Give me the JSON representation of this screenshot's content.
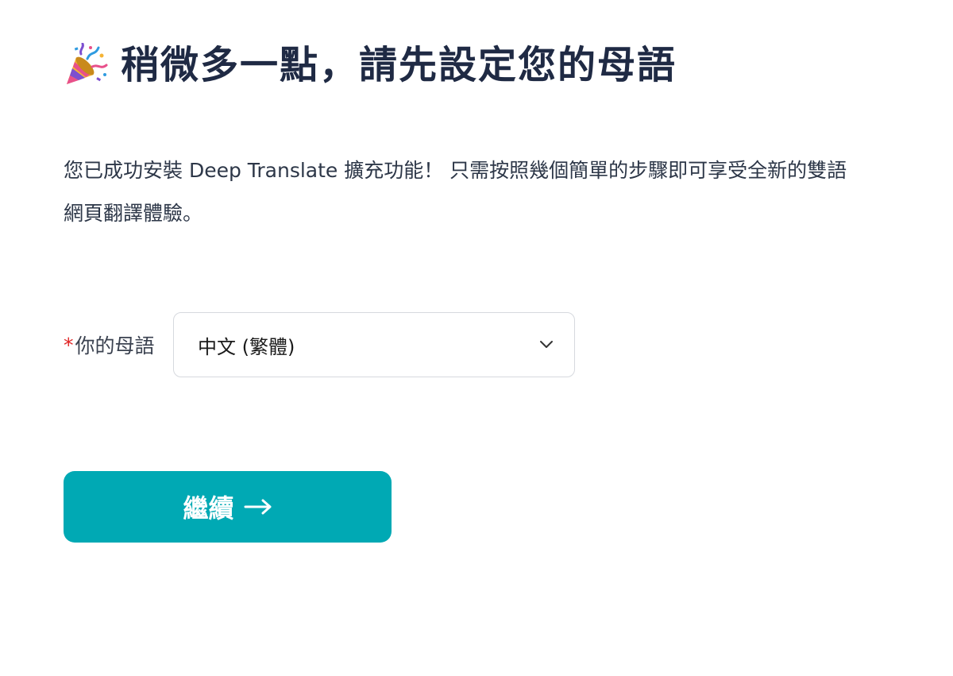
{
  "header": {
    "icon": "party-popper-icon",
    "title": "稍微多一點，請先設定您的母語"
  },
  "intro": {
    "text": "您已成功安裝 Deep Translate 擴充功能！ 只需按照幾個簡單的步驟即可享受全新的雙語網頁翻譯體驗。"
  },
  "language_form": {
    "required_mark": "*",
    "label": "你的母語",
    "selected_value": "中文 (繁體)",
    "dropdown_icon": "chevron-down-icon"
  },
  "actions": {
    "continue_label": "繼續",
    "continue_icon": "arrow-right-icon"
  },
  "colors": {
    "accent": "#00a9b4",
    "title": "#1f2a44",
    "required": "#e02424"
  }
}
